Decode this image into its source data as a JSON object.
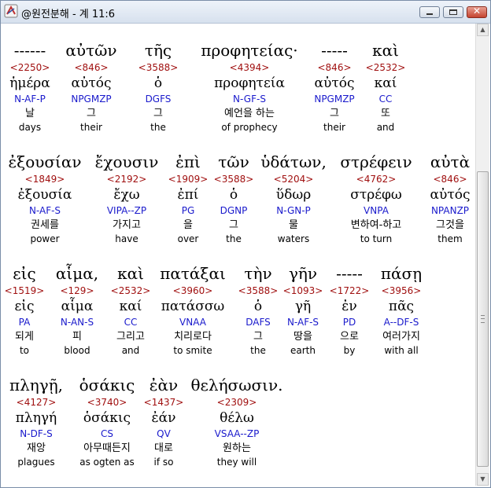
{
  "window": {
    "title": "@원전분해 - 계 11:6"
  },
  "rows": [
    [
      {
        "word": "------",
        "num": "<2250>",
        "lemma": "ἡμέρα",
        "morph": "N-AF-P",
        "ko": "날",
        "en": "days"
      },
      {
        "word": "αὐτῶν",
        "num": "<846>",
        "lemma": "αὐτός",
        "morph": "NPGMZP",
        "ko": "그",
        "en": "their"
      },
      {
        "word": "τῆς",
        "num": "<3588>",
        "lemma": "ὁ",
        "morph": "DGFS",
        "ko": "그",
        "en": "the"
      },
      {
        "word": "προφητείας·",
        "num": "<4394>",
        "lemma": "προφητεία",
        "morph": "N-GF-S",
        "ko": "예언을 하는",
        "en": "of prophecy"
      },
      {
        "word": "-----",
        "num": "<846>",
        "lemma": "αὐτός",
        "morph": "NPGMZP",
        "ko": "그",
        "en": "their"
      },
      {
        "word": "καὶ",
        "num": "<2532>",
        "lemma": "καί",
        "morph": "CC",
        "ko": "또",
        "en": "and"
      }
    ],
    [
      {
        "word": "ἐξουσίαν",
        "num": "<1849>",
        "lemma": "ἐξουσία",
        "morph": "N-AF-S",
        "ko": "권세를",
        "en": "power"
      },
      {
        "word": "ἔχουσιν",
        "num": "<2192>",
        "lemma": "ἔχω",
        "morph": "VIPA--ZP",
        "ko": "가지고",
        "en": "have"
      },
      {
        "word": "ἐπὶ",
        "num": "<1909>",
        "lemma": "ἐπί",
        "morph": "PG",
        "ko": "을",
        "en": "over"
      },
      {
        "word": "τῶν",
        "num": "<3588>",
        "lemma": "ὁ",
        "morph": "DGNP",
        "ko": "그",
        "en": "the"
      },
      {
        "word": "ὑδάτων,",
        "num": "<5204>",
        "lemma": "ὕδωρ",
        "morph": "N-GN-P",
        "ko": "물",
        "en": "waters"
      },
      {
        "word": "στρέφειν",
        "num": "<4762>",
        "lemma": "στρέφω",
        "morph": "VNPA",
        "ko": "변하여-하고",
        "en": "to turn"
      },
      {
        "word": "αὐτὰ",
        "num": "<846>",
        "lemma": "αὐτός",
        "morph": "NPANZP",
        "ko": "그것을",
        "en": "them"
      }
    ],
    [
      {
        "word": "εἰς",
        "num": "<1519>",
        "lemma": "εἰς",
        "morph": "PA",
        "ko": "되게",
        "en": "to"
      },
      {
        "word": "αἷμα,",
        "num": "<129>",
        "lemma": "αἷμα",
        "morph": "N-AN-S",
        "ko": "피",
        "en": "blood"
      },
      {
        "word": "καὶ",
        "num": "<2532>",
        "lemma": "καί",
        "morph": "CC",
        "ko": "그리고",
        "en": "and"
      },
      {
        "word": "πατάξαι",
        "num": "<3960>",
        "lemma": "πατάσσω",
        "morph": "VNAA",
        "ko": "치리로다",
        "en": "to smite"
      },
      {
        "word": "τὴν",
        "num": "<3588>",
        "lemma": "ὁ",
        "morph": "DAFS",
        "ko": "그",
        "en": "the"
      },
      {
        "word": "γῆν",
        "num": "<1093>",
        "lemma": "γῆ",
        "morph": "N-AF-S",
        "ko": "땅을",
        "en": "earth"
      },
      {
        "word": "-----",
        "num": "<1722>",
        "lemma": "ἐν",
        "morph": "PD",
        "ko": "으로",
        "en": "by"
      },
      {
        "word": "πάσῃ",
        "num": "<3956>",
        "lemma": "πᾶς",
        "morph": "A--DF-S",
        "ko": "여러가지",
        "en": "with all"
      }
    ],
    [
      {
        "word": "πληγῇ,",
        "num": "<4127>",
        "lemma": "πληγή",
        "morph": "N-DF-S",
        "ko": "재앙",
        "en": "plagues"
      },
      {
        "word": "ὁσάκις",
        "num": "<3740>",
        "lemma": "ὁσάκις",
        "morph": "CS",
        "ko": "아무때든지",
        "en": "as ogten as"
      },
      {
        "word": "ἐὰν",
        "num": "<1437>",
        "lemma": "ἐάν",
        "morph": "QV",
        "ko": "대로",
        "en": "if so"
      },
      {
        "word": "θελήσωσιν.",
        "num": "<2309>",
        "lemma": "θέλω",
        "morph": "VSAA--ZP",
        "ko": "원하는",
        "en": "they will"
      }
    ]
  ]
}
